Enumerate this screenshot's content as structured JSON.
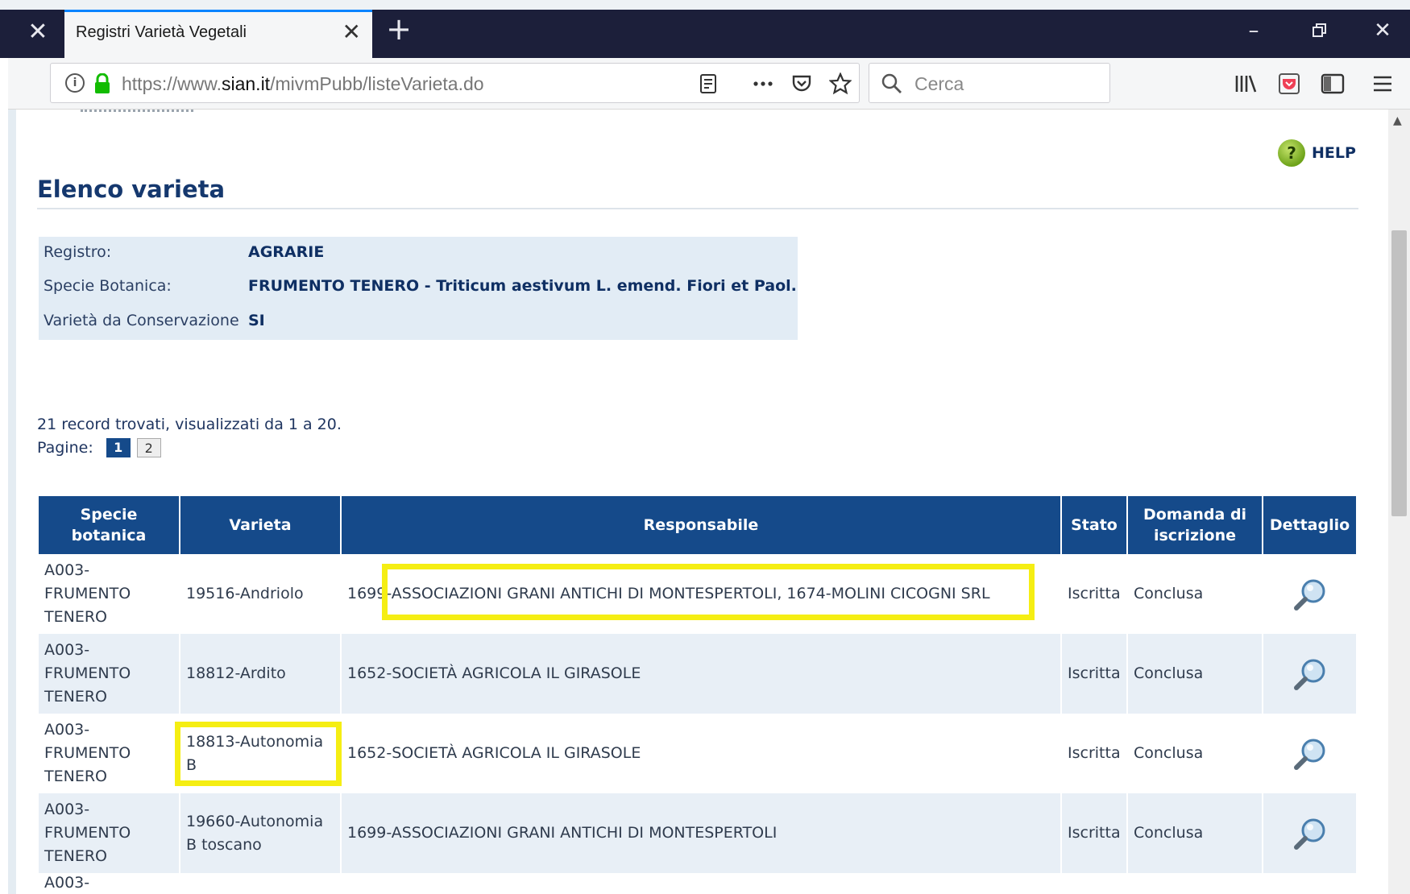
{
  "browser": {
    "tab_title": "Registri Varietà Vegetali",
    "url_prefix": "https://www.",
    "url_domain": "sian.it",
    "url_path": "/mivmPubb/listeVarieta.do",
    "search_placeholder": "Cerca",
    "accent_color": "#0a84ff"
  },
  "page": {
    "help_label": "HELP",
    "title": "Elenco varieta",
    "info": [
      {
        "label": "Registro:",
        "value": "AGRARIE"
      },
      {
        "label": "Specie Botanica:",
        "value": "FRUMENTO TENERO - Triticum aestivum L. emend. Fiori et Paol."
      },
      {
        "label": "Varietà da Conservazione",
        "value": "SI"
      }
    ],
    "records_text": "21 record trovati, visualizzati da 1 a 20.",
    "pages_label": "Pagine:",
    "pages": [
      "1",
      "2"
    ],
    "current_page": "1"
  },
  "table": {
    "header_color": "#154a8a",
    "highlight_color": "#f5ee13",
    "columns": [
      "Specie botanica",
      "Varieta",
      "Responsabile",
      "Stato",
      "Domanda di iscrizione",
      "Dettaglio"
    ],
    "rows": [
      {
        "specie": "A003-FRUMENTO TENERO",
        "varieta": "19516-Andriolo",
        "responsabile": "1699-ASSOCIAZIONI GRANI ANTICHI DI MONTESPERTOLI, 1674-MOLINI CICOGNI SRL",
        "stato": "Iscritta",
        "domanda": "Conclusa",
        "detail_icon": "magnifier-icon"
      },
      {
        "specie": "A003-FRUMENTO TENERO",
        "varieta": "18812-Ardito",
        "responsabile": "1652-SOCIETÀ AGRICOLA IL GIRASOLE",
        "stato": "Iscritta",
        "domanda": "Conclusa",
        "detail_icon": "magnifier-icon"
      },
      {
        "specie": "A003-FRUMENTO TENERO",
        "varieta": "18813-Autonomia B",
        "responsabile": "1652-SOCIETÀ AGRICOLA IL GIRASOLE",
        "stato": "Iscritta",
        "domanda": "Conclusa",
        "detail_icon": "magnifier-icon"
      },
      {
        "specie": "A003-FRUMENTO TENERO",
        "varieta": "19660-Autonomia B toscano",
        "responsabile": "1699-ASSOCIAZIONI GRANI ANTICHI DI MONTESPERTOLI",
        "stato": "Iscritta",
        "domanda": "Conclusa",
        "detail_icon": "magnifier-icon"
      }
    ],
    "partial_row_text": "A003-"
  }
}
